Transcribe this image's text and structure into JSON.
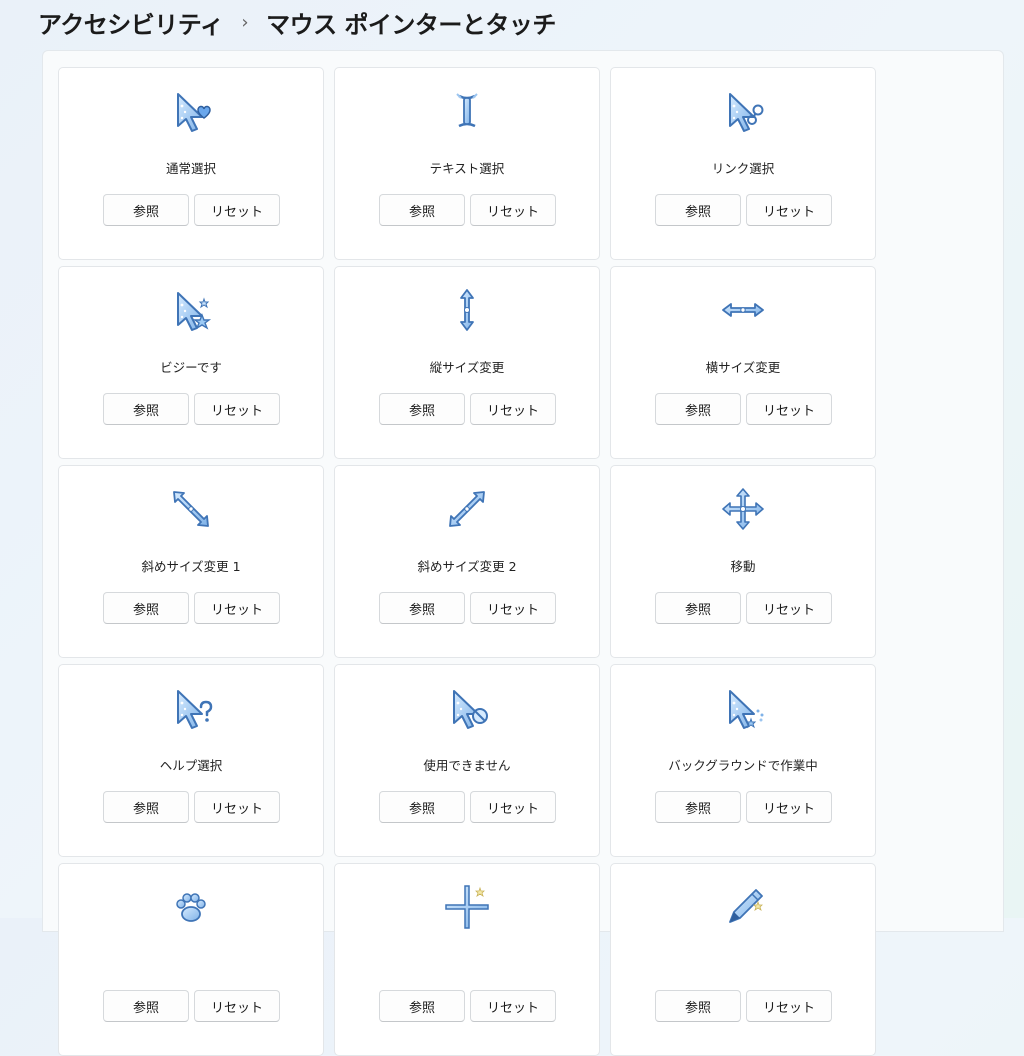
{
  "breadcrumb": {
    "parent": "アクセシビリティ",
    "separator": "›",
    "current": "マウス ポインターとタッチ"
  },
  "button_labels": {
    "browse": "参照",
    "reset": "リセット"
  },
  "cursors": [
    {
      "label": "通常選択",
      "icon": "arrow-heart-icon"
    },
    {
      "label": "テキスト選択",
      "icon": "text-beam-icon"
    },
    {
      "label": "リンク選択",
      "icon": "arrow-link-icon"
    },
    {
      "label": "ビジーです",
      "icon": "arrow-star-icon"
    },
    {
      "label": "縦サイズ変更",
      "icon": "vertical-resize-icon"
    },
    {
      "label": "横サイズ変更",
      "icon": "horizontal-resize-icon"
    },
    {
      "label": "斜めサイズ変更 1",
      "icon": "diagonal-resize-1-icon"
    },
    {
      "label": "斜めサイズ変更 2",
      "icon": "diagonal-resize-2-icon"
    },
    {
      "label": "移動",
      "icon": "move-icon"
    },
    {
      "label": "ヘルプ選択",
      "icon": "arrow-help-icon"
    },
    {
      "label": "使用できません",
      "icon": "arrow-unavailable-icon"
    },
    {
      "label": "バックグラウンドで作業中",
      "icon": "arrow-working-icon"
    },
    {
      "label": "",
      "icon": "paw-icon"
    },
    {
      "label": "",
      "icon": "precision-cross-icon"
    },
    {
      "label": "",
      "icon": "pen-icon"
    }
  ],
  "colors": {
    "icon_fill": "#a9cdf2",
    "icon_stroke": "#4a7fc0",
    "icon_dark": "#2f5f9e"
  }
}
